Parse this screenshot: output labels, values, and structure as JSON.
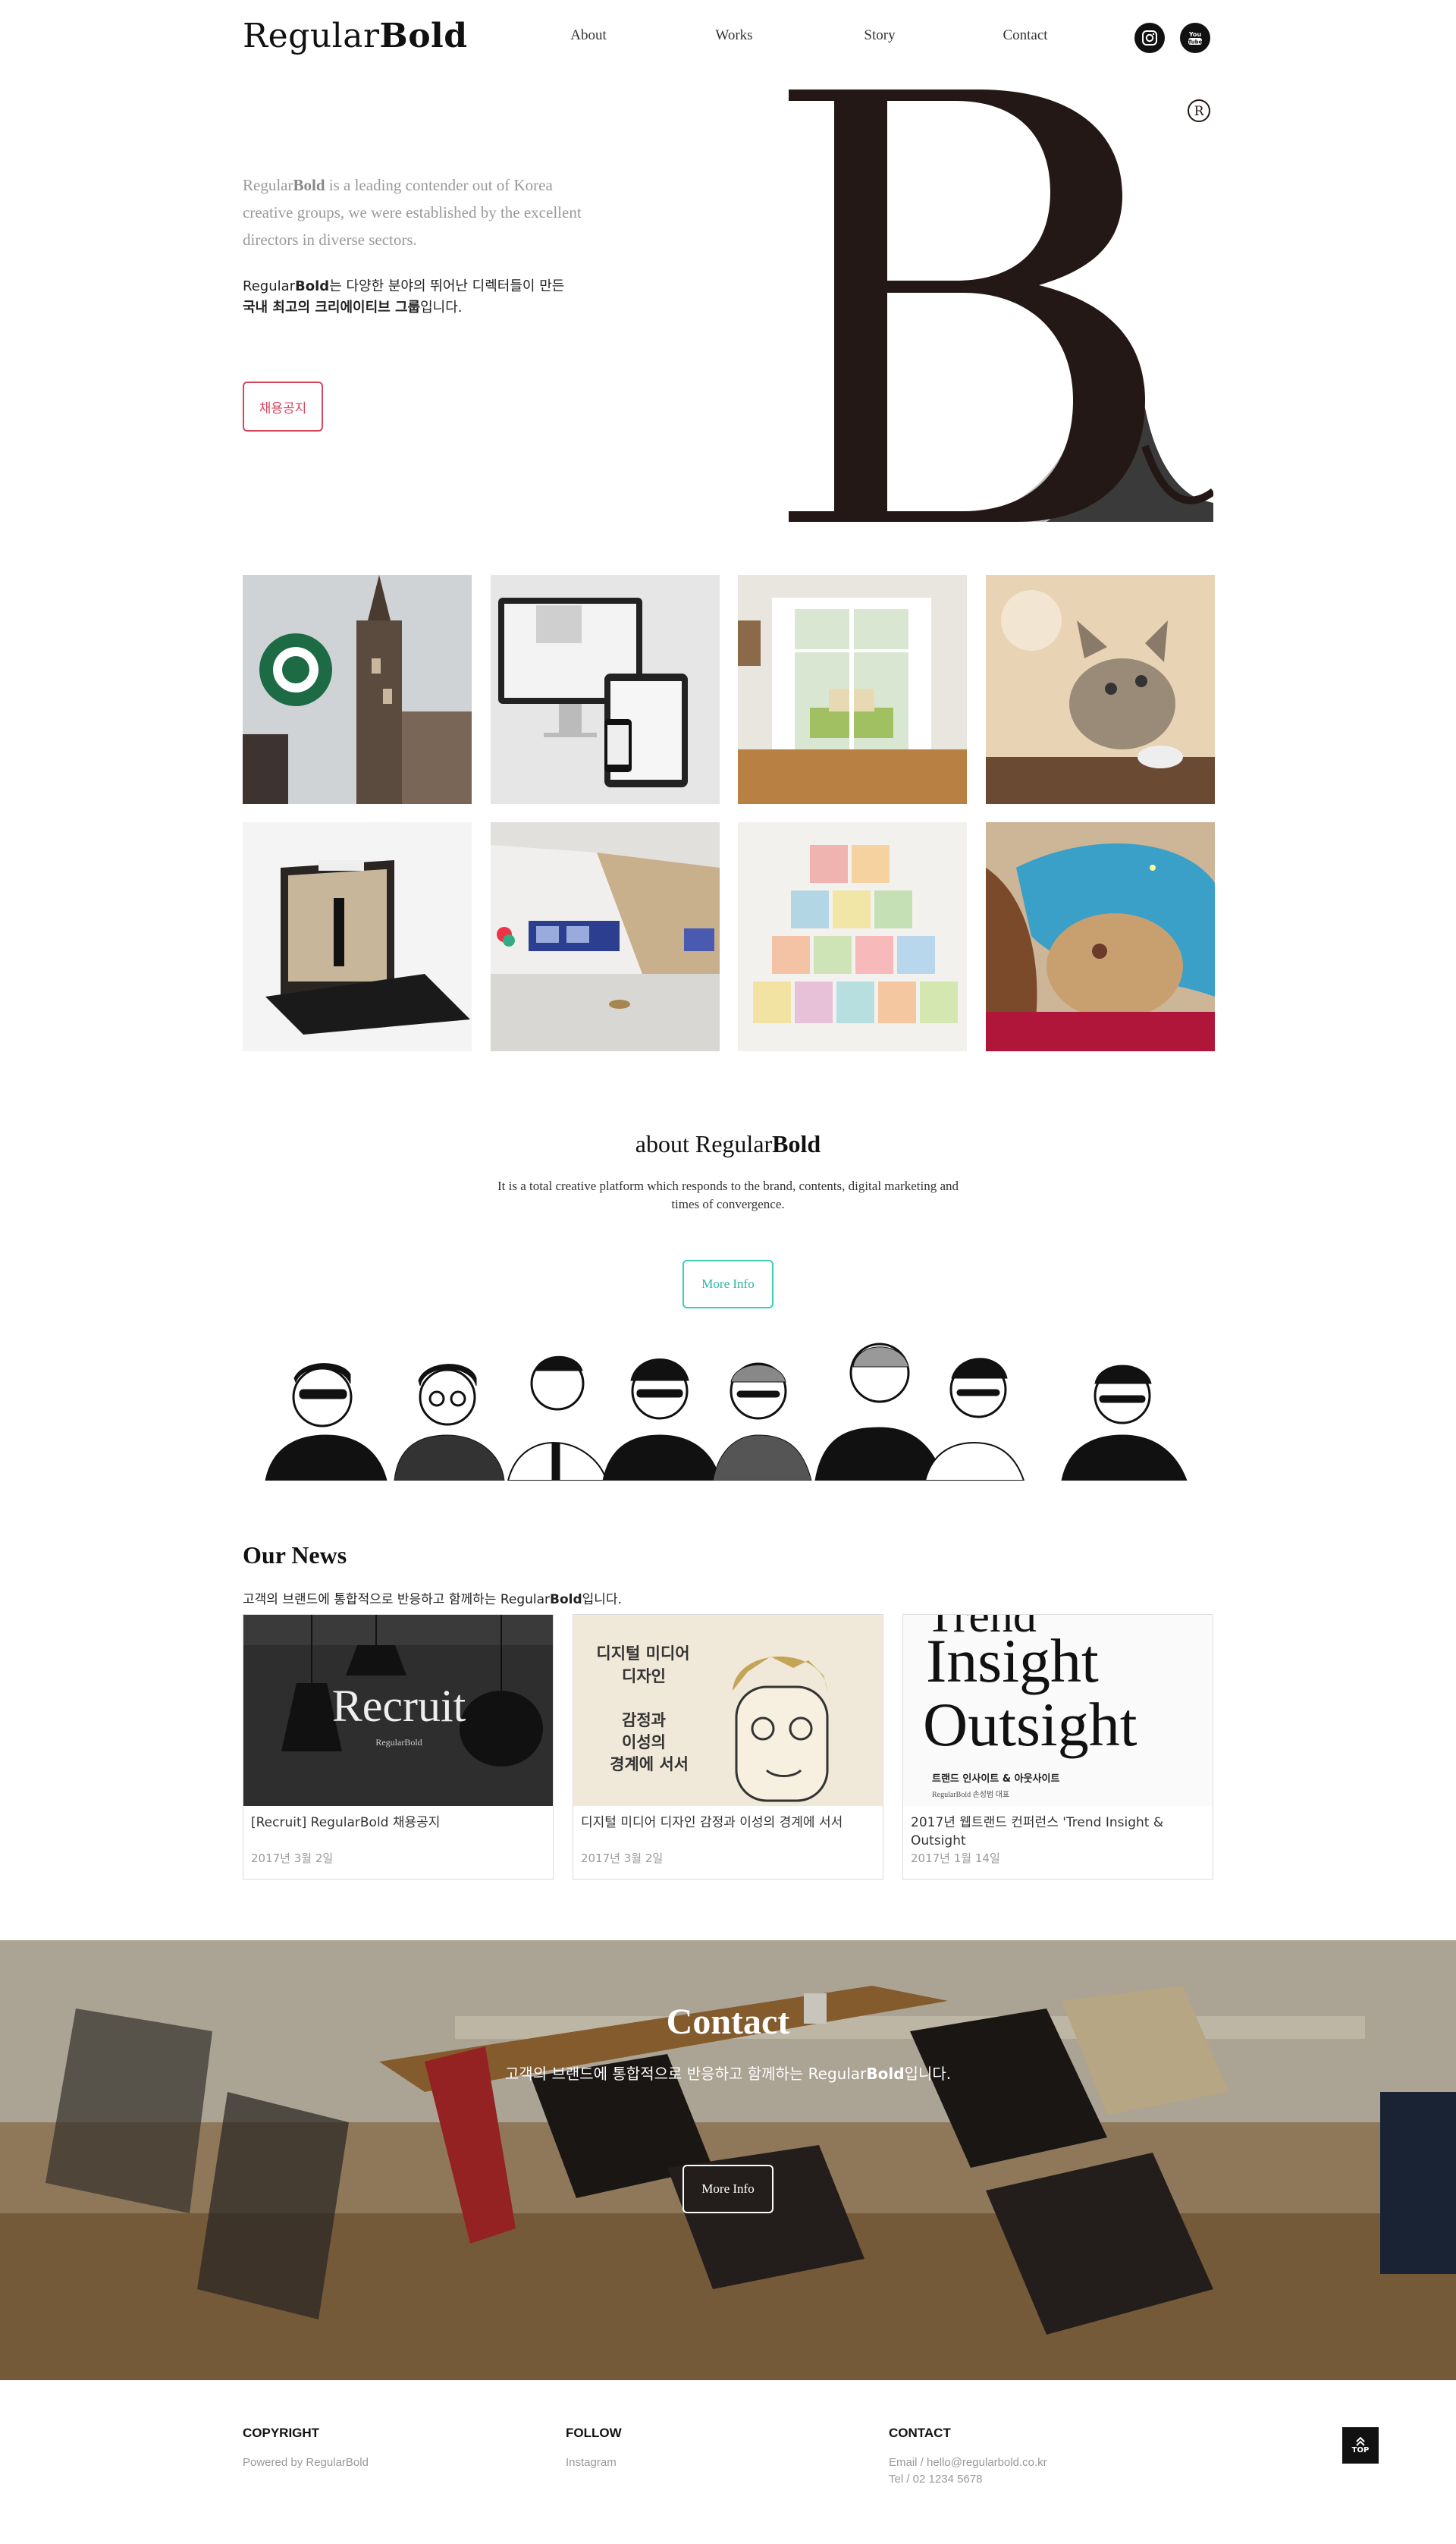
{
  "header": {
    "logo_regular": "Regular",
    "logo_bold": "Bold",
    "nav": [
      "About",
      "Works",
      "Story",
      "Contact"
    ],
    "social": [
      {
        "icon": "instagram-icon"
      },
      {
        "icon": "youtube-icon",
        "text": "You Tube"
      }
    ]
  },
  "hero": {
    "brand_regular": "Regular",
    "brand_bold": "Bold",
    "en_text": " is a leading contender out of Korea creative groups, we were established by the excellent directors in diverse sectors.",
    "ko_line1": "는 다양한 분야의 뛰어난 디렉터들이 만든",
    "ko_bold": "국내 최고의 크리에이티브 그룹",
    "ko_line2_tail": "입니다.",
    "recruit_button": "채용공지",
    "big_letter": "B",
    "registered_mark": "R"
  },
  "portfolio": [
    {
      "name": "starbucks-sign"
    },
    {
      "name": "responsive-devices"
    },
    {
      "name": "interior-doors"
    },
    {
      "name": "kitten"
    },
    {
      "name": "product-display-box"
    },
    {
      "name": "exhibition-space"
    },
    {
      "name": "we-can-make-words-cups"
    },
    {
      "name": "illustration-beach"
    }
  ],
  "about": {
    "title_regular": "about Regular",
    "title_bold": "Bold",
    "description": "It is a total creative platform which responds to the brand, contents, digital marketing and times of convergence.",
    "button": "More Info"
  },
  "news": {
    "title": "Our News",
    "subtitle_pre": "고객의 브랜드에 통합적으로 반응하고 함께하는 Regular",
    "subtitle_bold": "Bold",
    "subtitle_post": "입니다.",
    "cards": [
      {
        "title": "[Recruit] RegularBold 채용공지",
        "date": "2017년 3월 2일",
        "thumb_text": "Recruit",
        "thumb_sub": "RegularBold"
      },
      {
        "title": "디지털 미디어 디자인 감정과 이성의 경계에 서서",
        "date": "2017년 3월 2일",
        "thumb_lines": [
          "디지털 미디어",
          "디자인",
          "감정과",
          "이성의",
          "경계에 서서"
        ]
      },
      {
        "title": "2017년 웹트랜드 컨퍼런스 'Trend Insight & Outsight",
        "date": "2017년 1월 14일",
        "thumb_lines": [
          "Trend",
          "Insight",
          "Outsight"
        ],
        "thumb_sub": "트랜드 인사이트 & 아웃사이트",
        "thumb_byline": "RegularBold 손성범 대표"
      }
    ]
  },
  "contact": {
    "title": "Contact",
    "subtitle_pre": "고객의 브랜드에 통합적으로 반응하고 함께하는 Regular",
    "subtitle_bold": "Bold",
    "subtitle_post": "입니다.",
    "button": "More Info"
  },
  "footer": {
    "copyright_head": "COPYRIGHT",
    "copyright_text": "Powered by RegularBold",
    "follow_head": "FOLLOW",
    "follow_text": "Instagram",
    "contact_head": "CONTACT",
    "email": "Email / hello@regularbold.co.kr",
    "tel": "Tel / 02 1234 5678",
    "top_label": "TOP"
  },
  "colors": {
    "accent_red": "#d8465e",
    "accent_teal": "#3ccfb9",
    "text_dark": "#111111",
    "text_muted": "#9a9a9a"
  }
}
